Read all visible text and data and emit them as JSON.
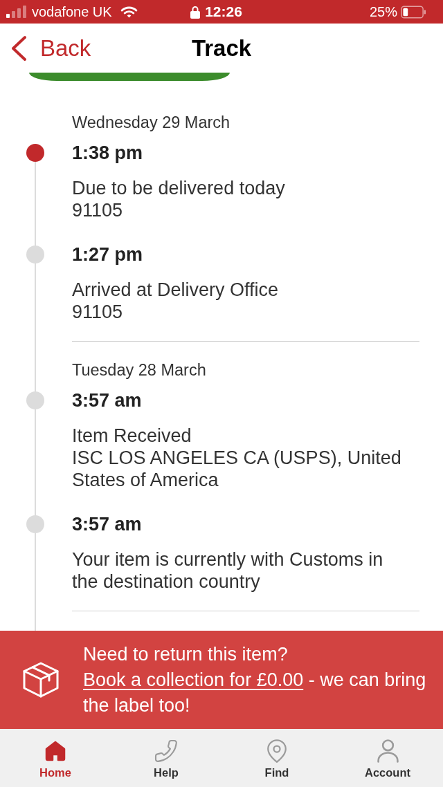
{
  "status_bar": {
    "carrier": "vodafone UK",
    "time": "12:26",
    "battery": "25%"
  },
  "nav": {
    "back": "Back",
    "title": "Track"
  },
  "days": [
    {
      "date": "Wednesday 29 March",
      "events": [
        {
          "time": "1:38 pm",
          "description": "Due to be delivered today",
          "location": "91105",
          "current": true
        },
        {
          "time": "1:27 pm",
          "description": "Arrived at Delivery Office",
          "location": "91105",
          "current": false
        }
      ]
    },
    {
      "date": "Tuesday 28 March",
      "events": [
        {
          "time": "3:57 am",
          "description": "Item Received",
          "location": "ISC LOS ANGELES CA (USPS), United States of America",
          "current": false
        },
        {
          "time": "3:57 am",
          "description": "Your item is currently with Customs in the destination country",
          "current": false
        }
      ]
    }
  ],
  "banner": {
    "message": "Need to return this item?",
    "link": "Book a collection for £0.00",
    "message_end": "- we can bring the label too!"
  },
  "tabs": [
    {
      "label": "Home",
      "selected": true
    },
    {
      "label": "Help",
      "selected": false
    },
    {
      "label": "Find",
      "selected": false
    },
    {
      "label": "Account",
      "selected": false
    }
  ]
}
